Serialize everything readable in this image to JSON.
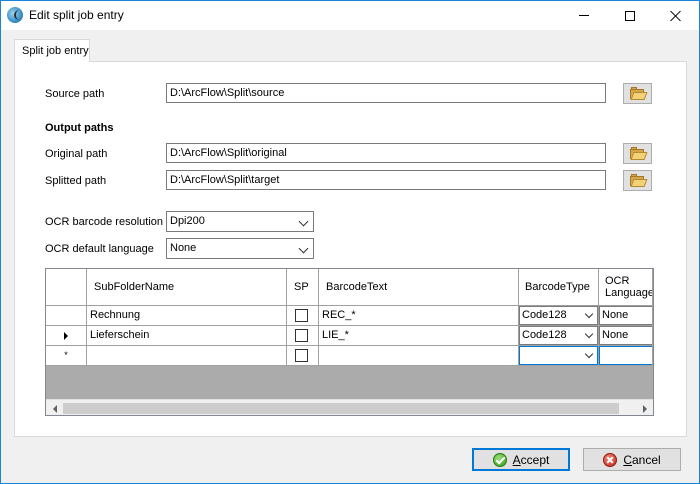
{
  "window": {
    "title": "Edit split job entry"
  },
  "tabs": [
    {
      "label": "Split job entry"
    }
  ],
  "form": {
    "source_path_label": "Source path",
    "source_path_value": "D:\\ArcFlow\\Split\\source",
    "output_section_title": "Output paths",
    "original_path_label": "Original path",
    "original_path_value": "D:\\ArcFlow\\Split\\original",
    "splitted_path_label": "Splitted path",
    "splitted_path_value": "D:\\ArcFlow\\Split\\target",
    "ocr_resolution_label": "OCR barcode resolution",
    "ocr_resolution_value": "Dpi200",
    "ocr_language_label": "OCR default language",
    "ocr_language_value": "None"
  },
  "grid": {
    "columns": [
      "SubFolderName",
      "SP",
      "BarcodeText",
      "BarcodeType",
      "OCR Language"
    ],
    "rows": [
      {
        "subfolder": "Rechnung",
        "sp": false,
        "barcode_text": "REC_*",
        "barcode_type": "Code128",
        "ocr_language": "None",
        "current": false
      },
      {
        "subfolder": "Lieferschein",
        "sp": false,
        "barcode_text": "LIE_*",
        "barcode_type": "Code128",
        "ocr_language": "None",
        "current": true
      }
    ],
    "new_row": {
      "subfolder": "",
      "barcode_text": "",
      "barcode_type": "",
      "ocr_language": ""
    }
  },
  "buttons": {
    "accept_label_first": "A",
    "accept_label_rest": "ccept",
    "cancel_label_first": "C",
    "cancel_label_rest": "ancel"
  },
  "icons": {
    "app": "arcflow-app-icon",
    "browse": "folder-open-icon",
    "accept": "check-circle-icon",
    "cancel": "x-circle-icon"
  },
  "colors": {
    "accent": "#0078d7",
    "window_border": "#1883d7"
  }
}
